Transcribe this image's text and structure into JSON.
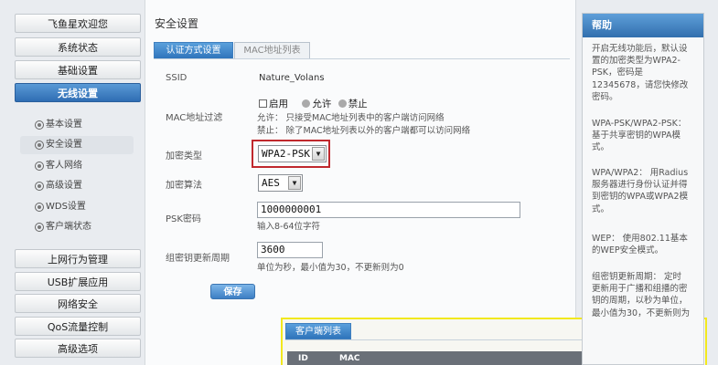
{
  "nav": {
    "top_items": [
      {
        "label": "飞鱼星欢迎您",
        "active": false
      },
      {
        "label": "系统状态",
        "active": false
      },
      {
        "label": "基础设置",
        "active": false
      },
      {
        "label": "无线设置",
        "active": true
      }
    ],
    "sub_items": [
      {
        "label": "基本设置",
        "active": false
      },
      {
        "label": "安全设置",
        "active": true
      },
      {
        "label": "客人网络",
        "active": false
      },
      {
        "label": "高级设置",
        "active": false
      },
      {
        "label": "WDS设置",
        "active": false
      },
      {
        "label": "客户端状态",
        "active": false
      }
    ],
    "bottom_items": [
      {
        "label": "上网行为管理"
      },
      {
        "label": "USB扩展应用"
      },
      {
        "label": "网络安全"
      },
      {
        "label": "QoS流量控制"
      },
      {
        "label": "高级选项"
      }
    ]
  },
  "main": {
    "title": "安全设置",
    "tabs": [
      {
        "label": "认证方式设置",
        "active": true
      },
      {
        "label": "MAC地址列表",
        "active": false
      }
    ],
    "ssid": {
      "label": "SSID",
      "value": "Nature_Volans"
    },
    "mac_filter": {
      "label": "MAC地址过滤",
      "enable_label": "启用",
      "allow_label": "允许",
      "deny_label": "禁止",
      "allow_hint": "允许：  只接受MAC地址列表中的客户端访问网络",
      "deny_hint": "禁止：  除了MAC地址列表以外的客户端都可以访问网络"
    },
    "encrypt_type": {
      "label": "加密类型",
      "value": "WPA2-PSK"
    },
    "encrypt_algo": {
      "label": "加密算法",
      "value": "AES"
    },
    "psk": {
      "label": "PSK密码",
      "value": "1000000001",
      "hint": "输入8-64位字符"
    },
    "group_key": {
      "label": "组密钥更新周期",
      "value": "3600",
      "hint": "单位为秒，最小值为30，不更新则为0"
    },
    "save_label": "保存",
    "client_list": {
      "tab_label": "客户端列表",
      "columns": [
        "ID",
        "MAC"
      ]
    }
  },
  "help": {
    "title": "帮助",
    "paragraphs": [
      "开启无线功能后，默认设\n置的加密类型为WPA2-\nPSK，密码是\n12345678，请您快修改\n密码。",
      "WPA-PSK/WPA2-PSK：\n基于共享密钥的WPA模\n式。",
      "WPA/WPA2：  用Radius\n服务器进行身份认证并得\n到密钥的WPA或WPA2模\n式。",
      "WEP：  使用802.11基本\n的WEP安全模式。",
      "组密钥更新周期：  定时\n更新用于广播和组播的密\n钥的周期，以秒为单位，\n最小值为30，不更新则为"
    ]
  },
  "colors": {
    "accent": "#2f74bb",
    "highlight_red": "#c0282d",
    "highlight_yellow": "#f2e81e"
  }
}
